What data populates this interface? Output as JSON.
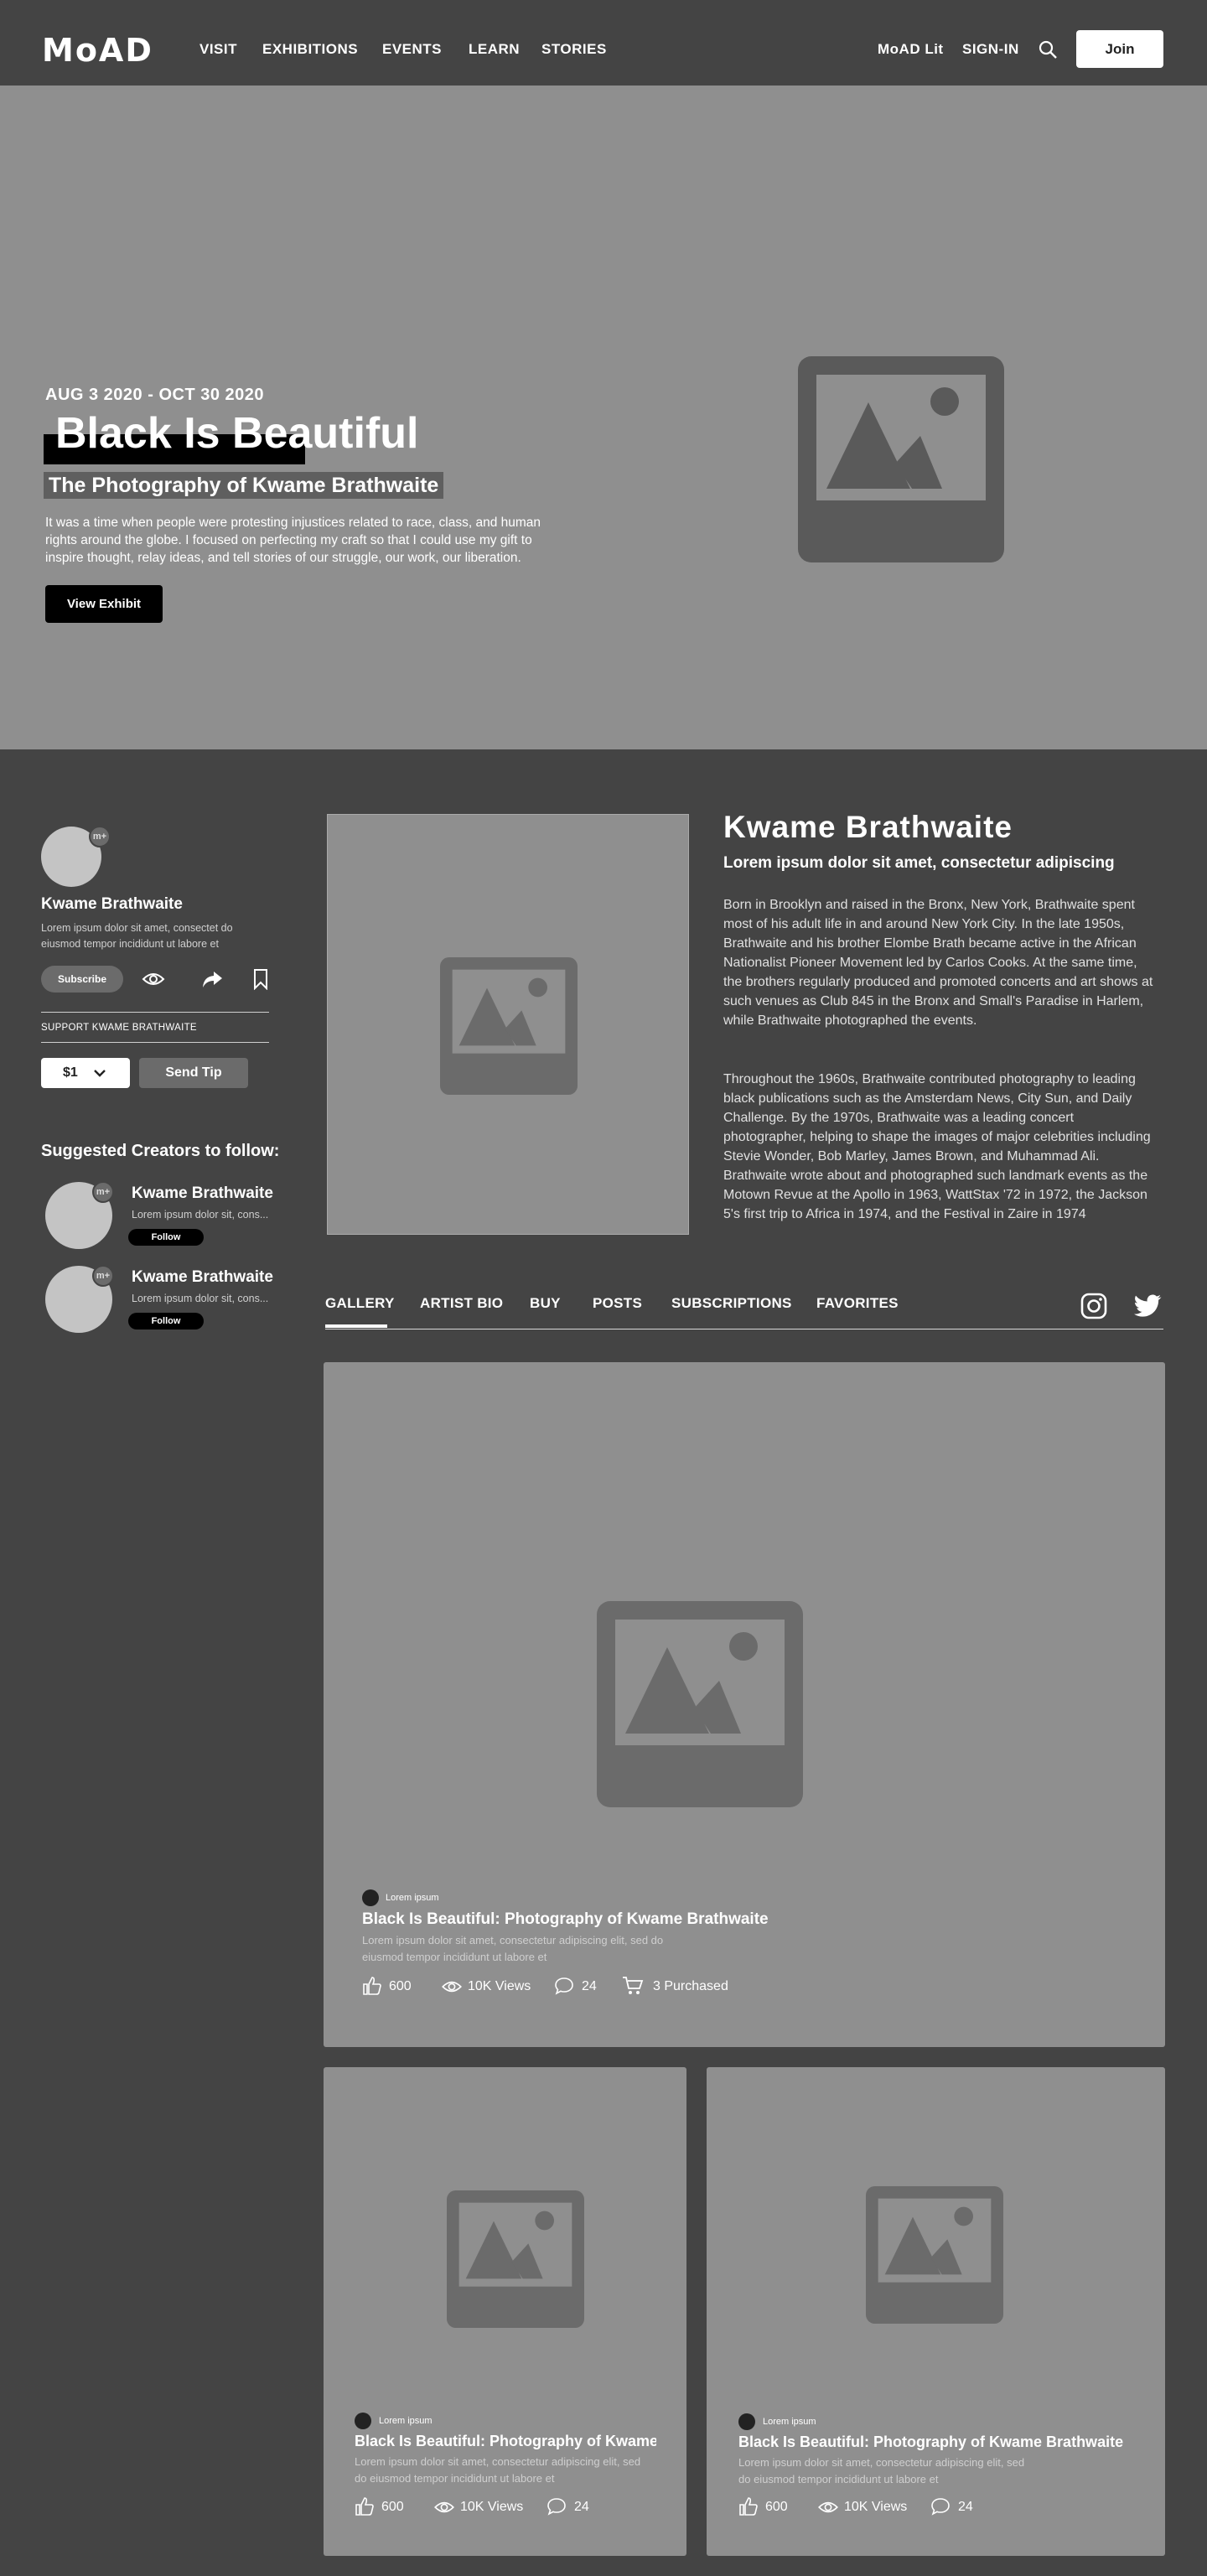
{
  "nav": {
    "logo": "MoAD",
    "links": [
      "VISIT",
      "EXHIBITIONS",
      "EVENTS",
      "LEARN",
      "STORIES"
    ],
    "lit": "MoAD Lit",
    "signin": "SIGN-IN",
    "join": "Join"
  },
  "hero": {
    "date": "AUG 3 2020 - OCT 30 2020",
    "title": "Black Is Beautiful",
    "subtitle": "The Photography of Kwame Brathwaite",
    "description": "It was a time when people were protesting injustices related to race, class, and human rights around the globe. I focused on perfecting my craft so that I could use my gift to inspire thought, relay ideas, and tell stories of our struggle, our work, our liberation.",
    "button": "View Exhibit"
  },
  "creator": {
    "name": "Kwame Brathwaite",
    "description": "Lorem ipsum dolor sit amet, consectet do eiusmod tempor incididunt ut labore et",
    "subscribe": "Subscribe",
    "support_label": "SUPPORT KWAME BRATHWAITE",
    "amount": "$1",
    "tip_button": "Send Tip"
  },
  "suggested": {
    "title": "Suggested Creators to follow:",
    "items": [
      {
        "name": "Kwame Brathwaite",
        "desc": "Lorem ipsum dolor sit, cons...",
        "follow": "Follow"
      },
      {
        "name": "Kwame Brathwaite",
        "desc": "Lorem ipsum dolor sit, cons...",
        "follow": "Follow"
      }
    ]
  },
  "bio": {
    "name": "Kwame Brathwaite",
    "tagline": "Lorem ipsum dolor sit amet, consectetur adipiscing",
    "para1": "Born in Brooklyn and raised in the Bronx, New York, Brathwaite spent most of his adult life in and around New York City. In the late 1950s, Brathwaite and his brother Elombe Brath became active in the African Nationalist Pioneer Movement led by Carlos Cooks. At the same time, the brothers regularly produced and promoted concerts and art shows at such venues as Club 845 in the Bronx and Small's Paradise in Harlem, while Brathwaite photographed the events.",
    "para2": "Throughout the 1960s, Brathwaite contributed photography to leading black publications such as the Amsterdam News, City Sun, and Daily Challenge. By the 1970s, Brathwaite was a leading concert photographer, helping to shape the images of major celebrities including Stevie Wonder, Bob Marley, James Brown, and Muhammad Ali. Brathwaite wrote about and photographed such landmark events as the Motown Revue at the Apollo in 1963, WattStax '72 in 1972, the Jackson 5's first trip to Africa in 1974, and the Festival in Zaire in 1974"
  },
  "tabs": [
    "GALLERY",
    "ARTIST BIO",
    "BUY",
    "POSTS",
    "SUBSCRIPTIONS",
    "FAVORITES"
  ],
  "featured": {
    "author": "Lorem ipsum",
    "title": "Black Is Beautiful: Photography of Kwame Brathwaite",
    "desc": "Lorem ipsum dolor sit amet, consectetur adipiscing elit, sed do eiusmod tempor incididunt ut labore et",
    "likes": "600",
    "views": "10K Views",
    "comments": "24",
    "purchased": "3 Purchased"
  },
  "cards": [
    {
      "author": "Lorem ipsum",
      "title": "Black Is Beautiful: Photography of Kwame Brathwaite",
      "desc": "Lorem ipsum dolor sit amet, consectetur adipiscing elit, sed do eiusmod tempor incididunt ut labore et",
      "likes": "600",
      "views": "10K Views",
      "comments": "24"
    },
    {
      "author": "Lorem ipsum",
      "title": "Black Is Beautiful: Photography of Kwame Brathwaite",
      "desc": "Lorem ipsum dolor sit amet, consectetur adipiscing elit, sed do eiusmod tempor incididunt ut labore et",
      "likes": "600",
      "views": "10K Views",
      "comments": "24"
    }
  ],
  "colors": {
    "background": "#444444",
    "panel": "#8f8f8f",
    "placeholder": "#6b6b6b",
    "accent": "#000000"
  },
  "icons": [
    "search-icon",
    "eye-icon",
    "share-icon",
    "bookmark-icon",
    "chevron-down-icon",
    "instagram-icon",
    "twitter-icon",
    "like-icon",
    "views-icon",
    "comment-icon",
    "cart-icon",
    "image-placeholder-icon"
  ]
}
